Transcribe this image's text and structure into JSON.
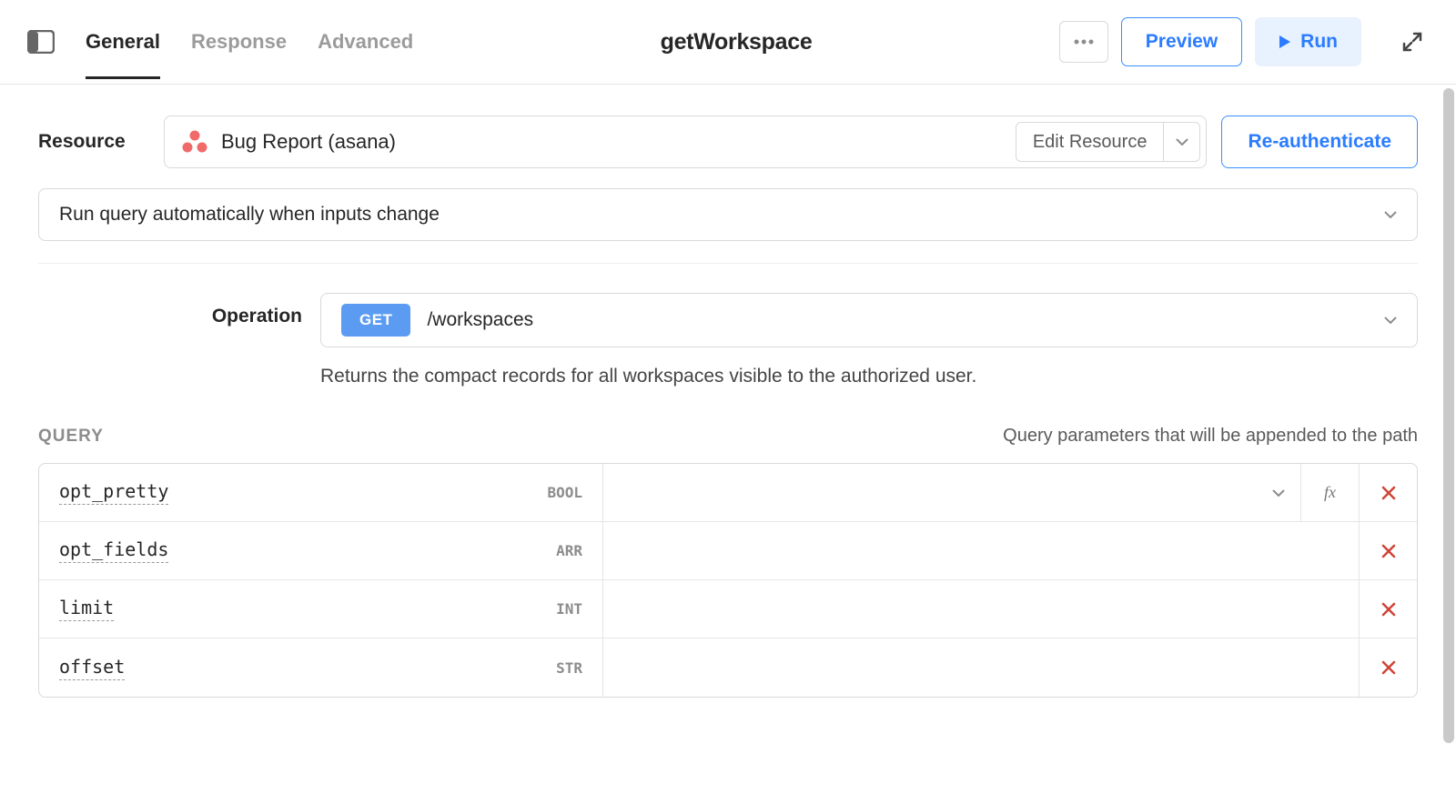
{
  "header": {
    "tabs": [
      "General",
      "Response",
      "Advanced"
    ],
    "active_tab": 0,
    "title": "getWorkspace",
    "preview_label": "Preview",
    "run_label": "Run"
  },
  "resource": {
    "label": "Resource",
    "name": "Bug Report (asana)",
    "edit_label": "Edit Resource",
    "reauth_label": "Re-authenticate"
  },
  "run_mode": {
    "selected": "Run query automatically when inputs change"
  },
  "operation": {
    "label": "Operation",
    "verb": "GET",
    "path": "/workspaces",
    "description": "Returns the compact records for all workspaces visible to the authorized user."
  },
  "query_section": {
    "title": "QUERY",
    "hint": "Query parameters that will be appended to the path",
    "params": [
      {
        "name": "opt_pretty",
        "type": "BOOL",
        "value": "",
        "has_dropdown": true,
        "has_fx": true
      },
      {
        "name": "opt_fields",
        "type": "ARR",
        "value": "",
        "has_dropdown": false,
        "has_fx": false
      },
      {
        "name": "limit",
        "type": "INT",
        "value": "",
        "has_dropdown": false,
        "has_fx": false
      },
      {
        "name": "offset",
        "type": "STR",
        "value": "",
        "has_dropdown": false,
        "has_fx": false
      }
    ]
  },
  "icons": {
    "fx_label": "fx"
  }
}
